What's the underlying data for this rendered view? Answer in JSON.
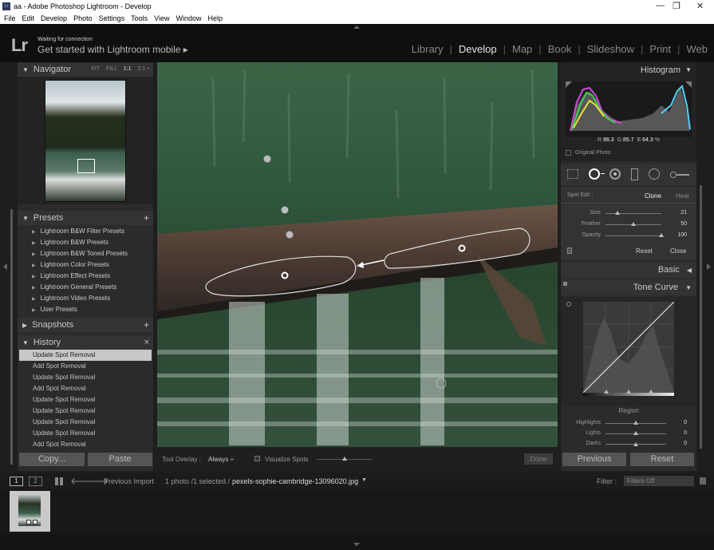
{
  "window": {
    "title": "aa - Adobe Photoshop Lightroom - Develop",
    "app_icon": "Lr",
    "controls": [
      "—",
      "❐",
      "✕"
    ]
  },
  "menubar": [
    "File",
    "Edit",
    "Develop",
    "Photo",
    "Settings",
    "Tools",
    "View",
    "Window",
    "Help"
  ],
  "identity": {
    "logo": "Lr",
    "status": "Waiting for connection",
    "cta": "Get started with Lightroom mobile ▸"
  },
  "modules": [
    {
      "label": "Library",
      "active": false
    },
    {
      "label": "Develop",
      "active": true
    },
    {
      "label": "Map",
      "active": false
    },
    {
      "label": "Book",
      "active": false
    },
    {
      "label": "Slideshow",
      "active": false
    },
    {
      "label": "Print",
      "active": false
    },
    {
      "label": "Web",
      "active": false
    }
  ],
  "navigator": {
    "title": "Navigator",
    "zoom_options": [
      "FIT",
      "FILL",
      "1:1",
      "2:1 ÷"
    ],
    "zoom_selected": "1:1"
  },
  "presets": {
    "title": "Presets",
    "add": "+",
    "items": [
      "Lightroom B&W Filter Presets",
      "Lightroom B&W Presets",
      "Lightroom B&W Toned Presets",
      "Lightroom Color Presets",
      "Lightroom Effect Presets",
      "Lightroom General Presets",
      "Lightroom Video Presets",
      "User Presets"
    ]
  },
  "snapshots": {
    "title": "Snapshots",
    "add": "+"
  },
  "history": {
    "title": "History",
    "clear": "×",
    "items": [
      "Update Spot Removal",
      "Add Spot Removal",
      "Update Spot Removal",
      "Add Spot Removal",
      "Update Spot Removal",
      "Update Spot Removal",
      "Update Spot Removal",
      "Update Spot Removal",
      "Add Spot Removal"
    ],
    "selected_index": 0
  },
  "left_buttons": {
    "copy": "Copy...",
    "paste": "Paste"
  },
  "toolbar": {
    "overlay_label": "Tool Overlay :",
    "overlay_value": "Always ÷",
    "visualize": "Visualize Spots",
    "done": "Done"
  },
  "histogram": {
    "title": "Histogram",
    "r_label": "R",
    "r_value": "86.3",
    "g_label": "G",
    "g_value": "85.7",
    "b_label": "B",
    "b_value": "64.3",
    "unit": "%",
    "original_photo": "Original Photo"
  },
  "spot_edit": {
    "label": "Spot Edit :",
    "clone": "Clone",
    "heal": "Heal",
    "size_label": "Size",
    "size_value": "21",
    "size_level": 0.22,
    "feather_label": "Feather",
    "feather_value": "50",
    "feather_level": 0.5,
    "opacity_label": "Opacity",
    "opacity_value": "100",
    "opacity_level": 1.0,
    "reset": "Reset",
    "close": "Close"
  },
  "basic": {
    "title": "Basic"
  },
  "tone_curve": {
    "title": "Tone Curve",
    "region": "Region",
    "highlights_label": "Highlights",
    "highlights_value": "0",
    "lights_label": "Lights",
    "lights_value": "0",
    "darks_label": "Darks",
    "darks_value": "0"
  },
  "right_buttons": {
    "previous": "Previous",
    "reset": "Reset"
  },
  "filmbar": {
    "page1": "1",
    "page2": "2",
    "source": "Previous Import",
    "selection": "1 photo /1 selected /",
    "filename": "pexels-sophie-cambridge-13096020.jpg",
    "filter_label": "Filter :",
    "filter_value": "Filters Off"
  },
  "colors": {
    "panel_bg": "#2b2b2b",
    "header_bg": "#333333",
    "history_selected": "#c8c8c8",
    "active_module": "#e6e6e6"
  }
}
